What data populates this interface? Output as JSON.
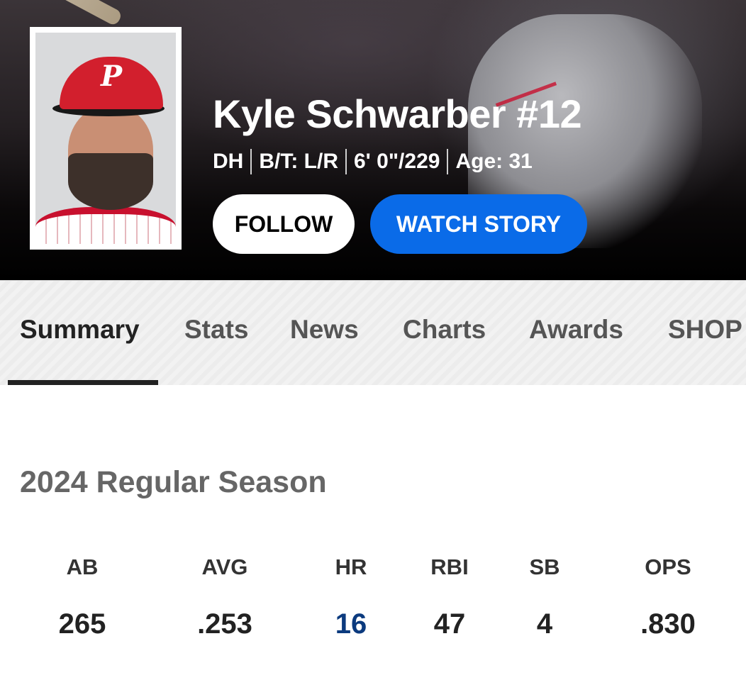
{
  "player": {
    "name": "Kyle Schwarber #12",
    "position": "DH",
    "bats_throws": "B/T: L/R",
    "height_weight": "6' 0\"/229",
    "age": "Age: 31",
    "cap_letter": "P"
  },
  "buttons": {
    "follow": "FOLLOW",
    "watch_story": "WATCH STORY"
  },
  "tabs": [
    {
      "label": "Summary",
      "active": true
    },
    {
      "label": "Stats"
    },
    {
      "label": "News"
    },
    {
      "label": "Charts"
    },
    {
      "label": "Awards"
    },
    {
      "label": "SHOP"
    }
  ],
  "season": {
    "title": "2024 Regular Season",
    "stats": [
      {
        "label": "AB",
        "value": "265"
      },
      {
        "label": "AVG",
        "value": ".253"
      },
      {
        "label": "HR",
        "value": "16",
        "highlight": true
      },
      {
        "label": "RBI",
        "value": "47"
      },
      {
        "label": "SB",
        "value": "4"
      },
      {
        "label": "OPS",
        "value": ".830"
      }
    ]
  },
  "colors": {
    "watch_button": "#0a6be8",
    "highlight_stat": "#0b3a7e",
    "team_red": "#c8102e"
  }
}
